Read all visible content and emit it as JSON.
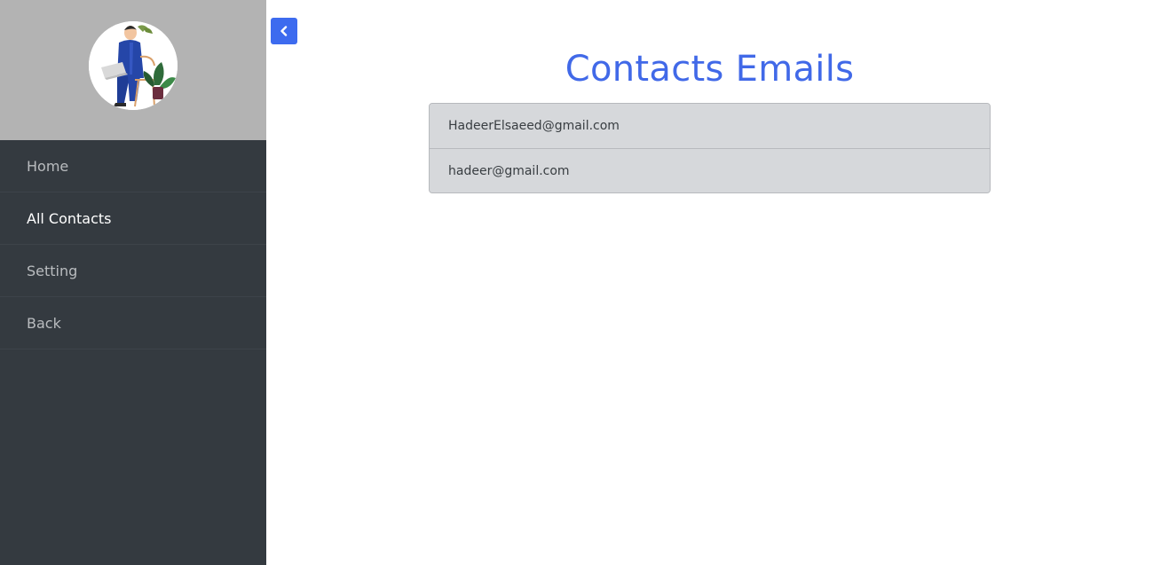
{
  "sidebar": {
    "avatar_icon": "person-with-laptop-illustration",
    "items": [
      {
        "label": "Home",
        "active": false
      },
      {
        "label": "All Contacts",
        "active": true
      },
      {
        "label": "Setting",
        "active": false
      },
      {
        "label": "Back",
        "active": false
      }
    ]
  },
  "toggle": {
    "icon": "chevron-left-icon",
    "color": "#3d6bef"
  },
  "main": {
    "title": "Contacts Emails",
    "title_color": "#4169e8",
    "emails": [
      "HadeerElsaeed@gmail.com",
      "hadeer@gmail.com"
    ]
  }
}
